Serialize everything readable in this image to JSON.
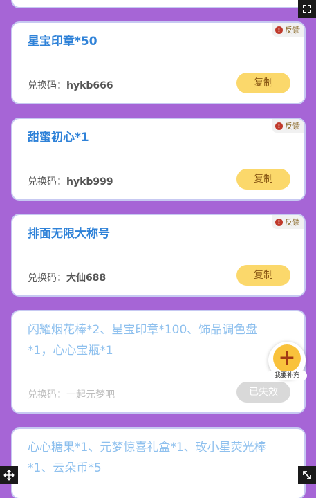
{
  "cards": [
    {
      "title": "星宝印章*50",
      "code_label": "兑换码：",
      "code_value": "hykb666",
      "button": "复制",
      "feedback": "反馈"
    },
    {
      "title": "甜蜜初心*1",
      "code_label": "兑换码：",
      "code_value": "hykb999",
      "button": "复制",
      "feedback": "反馈"
    },
    {
      "title": "排面无限大称号",
      "code_label": "兑换码：",
      "code_value": "大仙688",
      "button": "复制",
      "feedback": "反馈"
    },
    {
      "title": "闪耀烟花棒*2、星宝印章*100、饰品调色盘*1，心心宝瓶*1",
      "code_label": "兑换码：",
      "code_value": "一起元梦吧",
      "button": "已失效"
    },
    {
      "title": "心心糖果*1、元梦惊喜礼盒*1、玫小星荧光棒*1、云朵币*5"
    }
  ],
  "fab": {
    "icon": "+",
    "label": "我要补充"
  },
  "colors": {
    "background": "#a665d6",
    "title": "#2f82d8",
    "expired_title": "#8ec0ee",
    "copy_button": "#fbd86b",
    "expired_button": "#d9d9d9"
  },
  "icons": [
    "exclamation-circle-icon",
    "corner-expand-icon",
    "plus-icon",
    "move-icon"
  ]
}
